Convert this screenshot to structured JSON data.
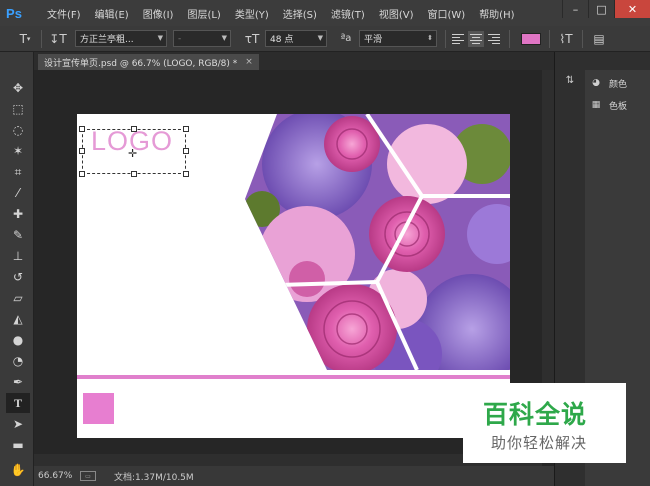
{
  "app": {
    "logo": "Ps"
  },
  "menu": [
    "文件(F)",
    "编辑(E)",
    "图像(I)",
    "图层(L)",
    "类型(Y)",
    "选择(S)",
    "滤镜(T)",
    "视图(V)",
    "窗口(W)",
    "帮助(H)"
  ],
  "window_controls": {
    "min": "–",
    "max": "□",
    "close": "✕"
  },
  "options": {
    "font_family": "方正兰亭粗...",
    "font_style": "-",
    "font_size": "48 点",
    "aa_label": "ªa",
    "aa_mode": "平滑",
    "text_color": "#e075c4"
  },
  "document": {
    "tab_title": "设计宣传单页.psd @ 66.7% (LOGO, RGB/8) *",
    "tab_close": "×",
    "logo_text": "LOGO",
    "accent_color": "#e07fcc"
  },
  "status": {
    "zoom": "66.67%",
    "doc_info": "文档:1.37M/10.5M"
  },
  "panels": [
    {
      "label": "颜色",
      "icon": "palette-icon"
    },
    {
      "label": "色板",
      "icon": "swatches-icon"
    }
  ],
  "watermark": {
    "title": "百科全说",
    "subtitle": "助你轻松解决"
  }
}
